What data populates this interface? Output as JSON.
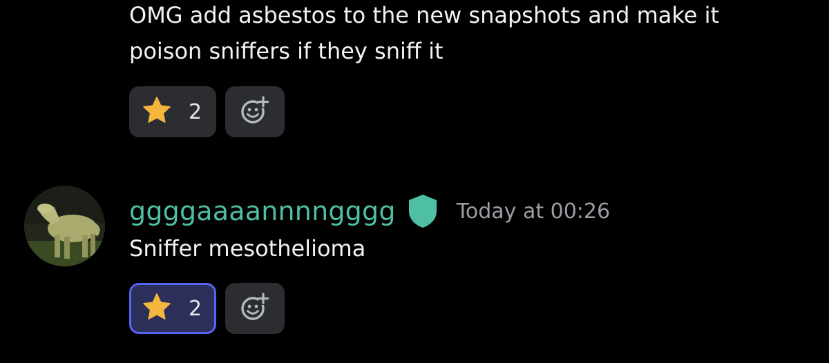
{
  "colors": {
    "background": "#000000",
    "message_text": "#f2f3f5",
    "username": "#4fbfa3",
    "role_badge": "#4fbfa3",
    "timestamp": "#9b9ea4",
    "reaction_bg": "#2b2d31",
    "reaction_active_border": "#5865f2",
    "star": "#f4b63c"
  },
  "message1": {
    "lines": [
      "OMG add asbestos to the new snapshots and make it",
      "poison sniffers if they sniff it"
    ],
    "reactions": [
      {
        "emoji": "star-icon",
        "count": "2",
        "active": false
      }
    ],
    "add_reaction_icon": "add-reaction-icon"
  },
  "message2": {
    "username": "ggggaaaannnngggg",
    "role_icon": "shield-icon",
    "timestamp": "Today at 00:26",
    "text": "Sniffer mesothelioma",
    "reactions": [
      {
        "emoji": "star-icon",
        "count": "2",
        "active": true
      }
    ],
    "add_reaction_icon": "add-reaction-icon"
  }
}
